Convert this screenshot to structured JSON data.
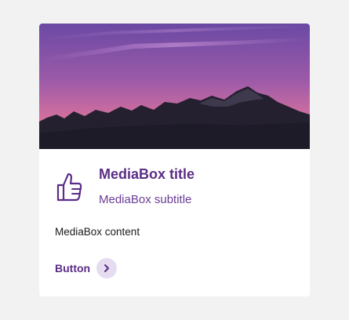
{
  "media_box": {
    "image_icon": "mountain-sunset-image",
    "icon": "thumbs-up-icon",
    "title": "MediaBox title",
    "subtitle": "MediaBox subtitle",
    "content": "MediaBox content",
    "button_label": "Button",
    "button_icon": "chevron-right-icon"
  },
  "colors": {
    "page_background": "#f2f2f2",
    "card_background": "#ffffff",
    "brand": "#5a2d86",
    "chevron_circle": "#e5dcef",
    "sky_top": "#6b4aa3",
    "sky_horizon": "#e07aa0",
    "mountains": "#1f1d2b"
  }
}
